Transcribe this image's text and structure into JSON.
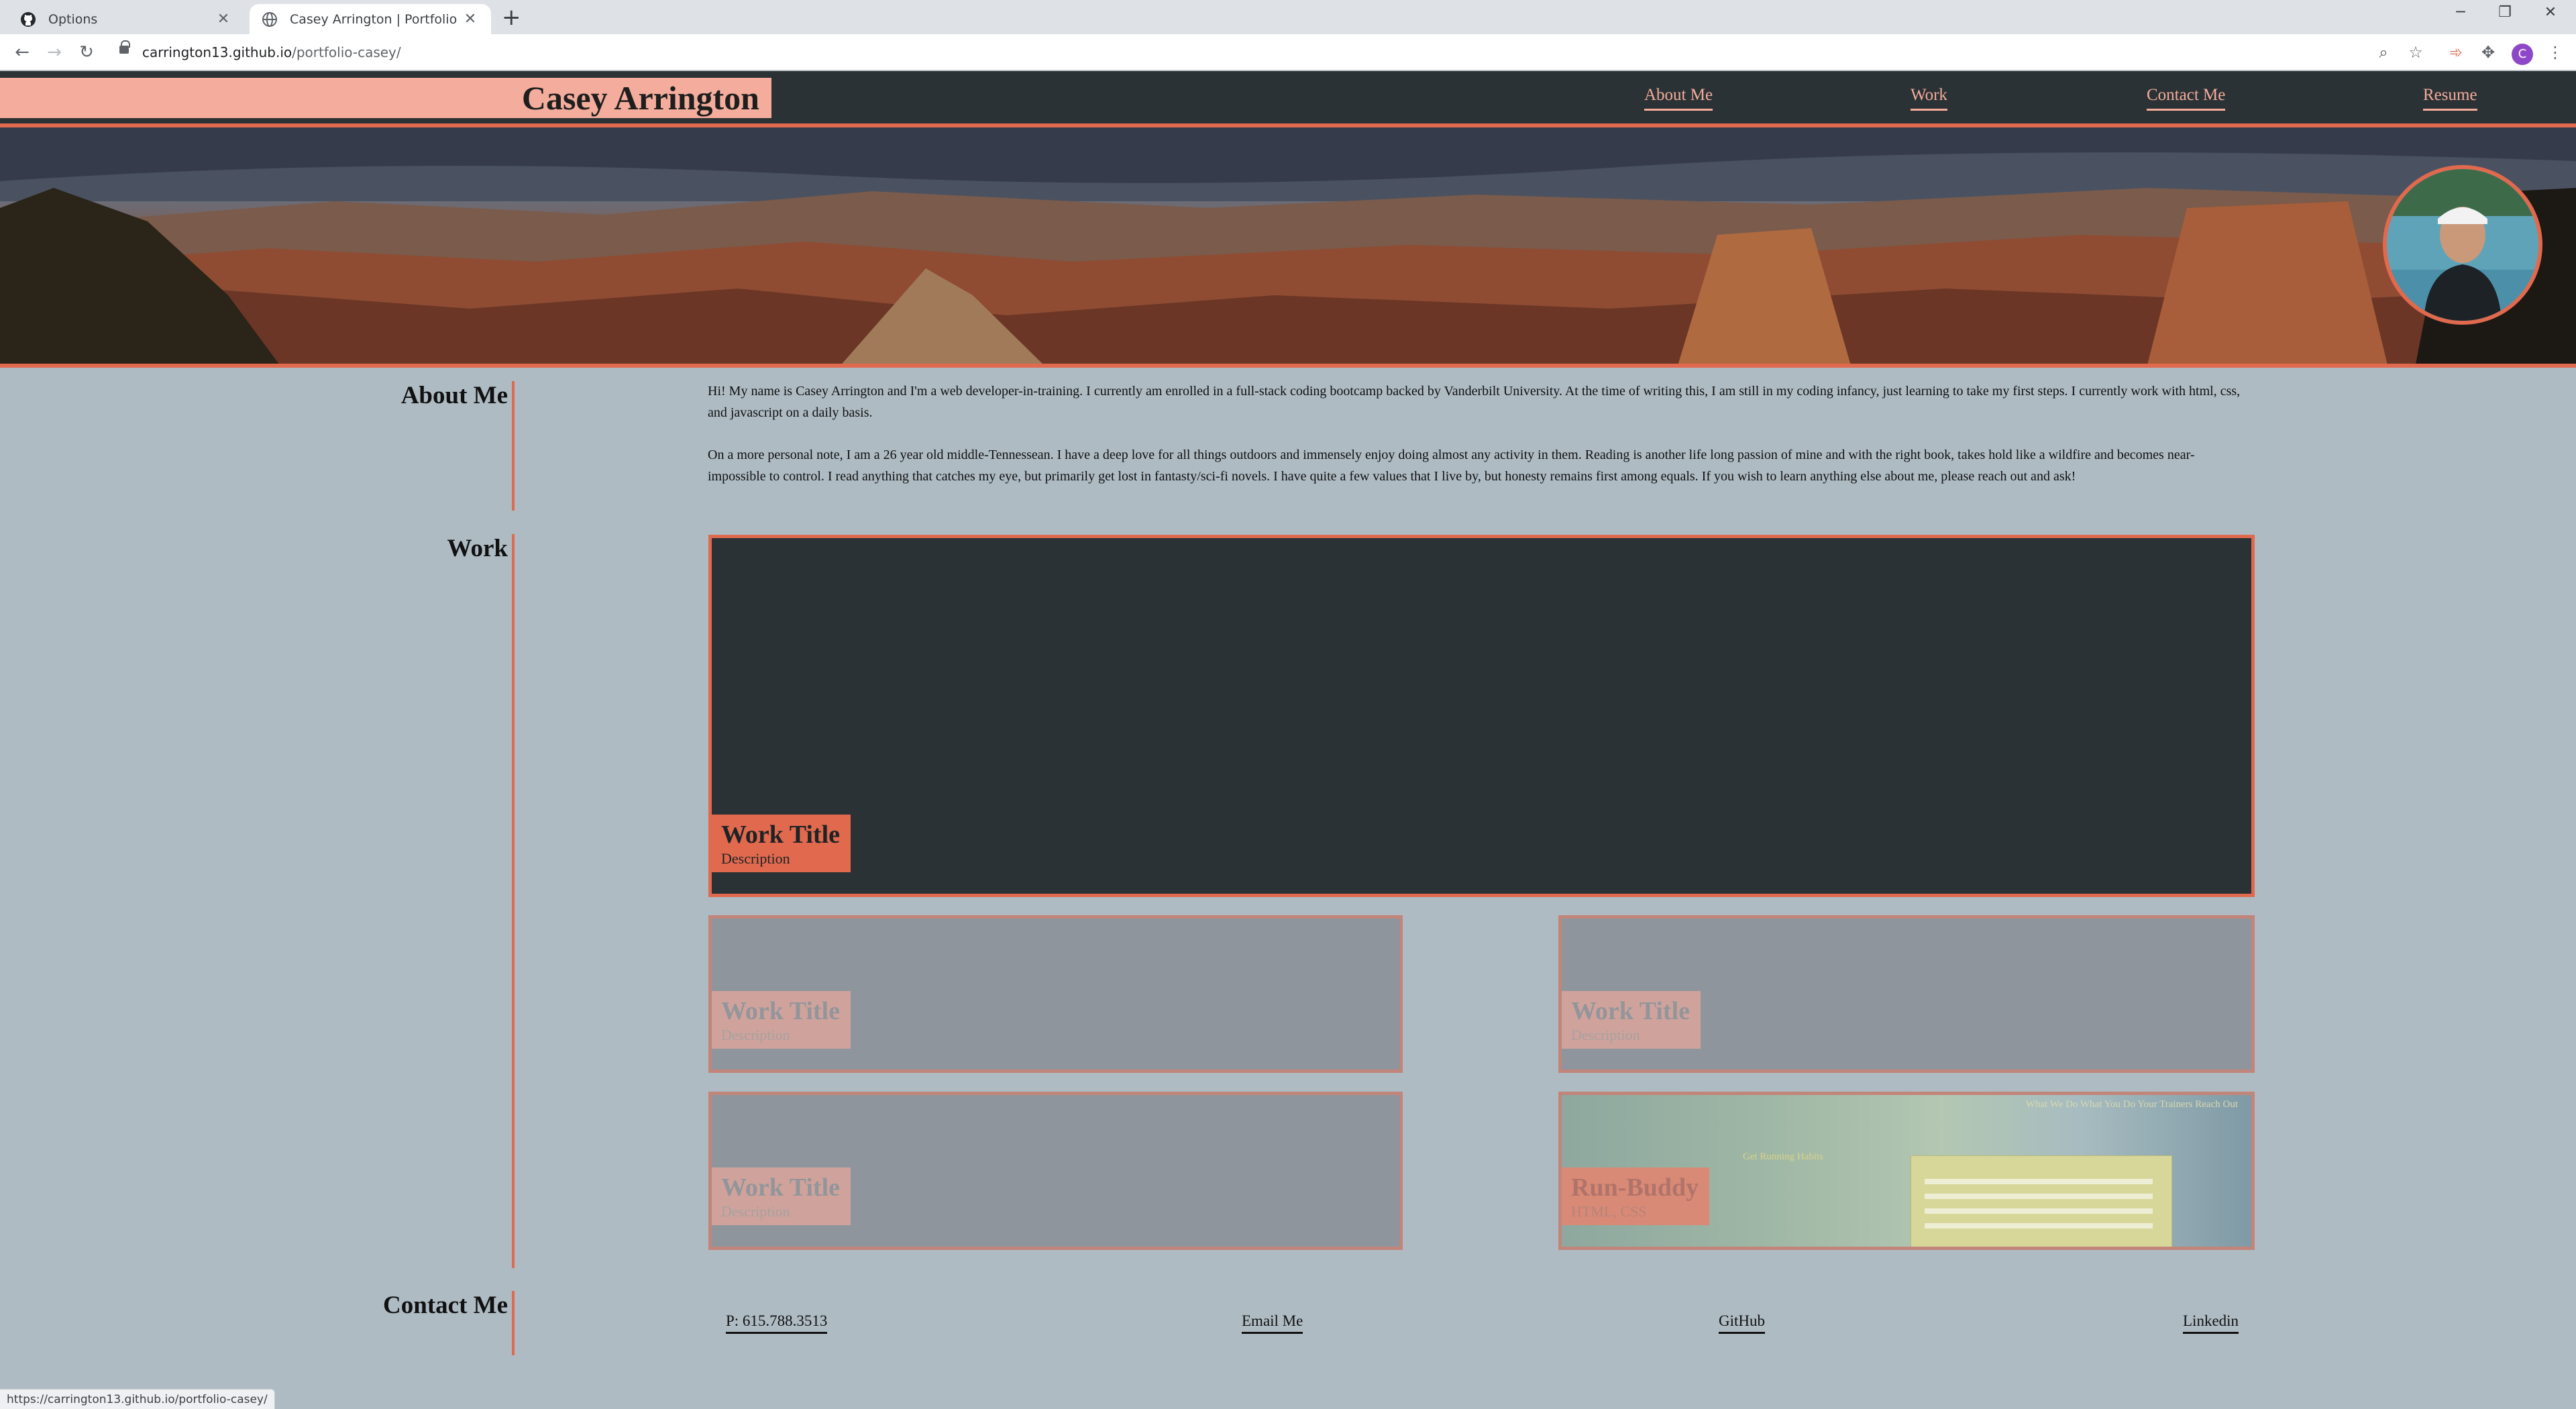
{
  "browser": {
    "tabs": [
      {
        "title": "Options",
        "favicon": "github-icon",
        "active": false
      },
      {
        "title": "Casey Arrington | Portfolio",
        "favicon": "globe-icon",
        "active": true
      }
    ],
    "address": {
      "host": "carrington13.github.io",
      "path": "/portfolio-casey/"
    },
    "profile_initial": "C",
    "status_url": "https://carrington13.github.io/portfolio-casey/"
  },
  "header": {
    "brand": "Casey Arrington",
    "nav": [
      "About Me",
      "Work",
      "Contact Me",
      "Resume"
    ]
  },
  "about": {
    "title": "About Me",
    "paragraphs": [
      "Hi! My name is Casey Arrington and I'm a web developer-in-training. I currently am enrolled in a full-stack coding bootcamp backed by Vanderbilt University. At the time of writing this, I am still in my coding infancy, just learning to take my first steps. I currently work with html, css, and javascript on a daily basis.",
      "On a more personal note, I am a 26 year old middle-Tennessean. I have a deep love for all things outdoors and immensely enjoy doing almost any activity in them. Reading is another life long passion of mine and with the right book, takes hold like a wildfire and becomes near-impossible to control. I read anything that catches my eye, but primarily get lost in fantasty/sci-fi novels. I have quite a few values that I live by, but honesty remains first among equals. If you wish to learn anything else about me, please reach out and ask!"
    ]
  },
  "work": {
    "title": "Work",
    "featured": {
      "title": "Work Title",
      "description": "Description"
    },
    "items": [
      {
        "title": "Work Title",
        "description": "Description"
      },
      {
        "title": "Work Title",
        "description": "Description"
      },
      {
        "title": "Work Title",
        "description": "Description"
      },
      {
        "title": "Run-Buddy",
        "description": "HTML, CSS",
        "preview_nav": "What We Do   What You Do   Your Trainers   Reach Out",
        "preview_headline": "Get Running Habits"
      }
    ]
  },
  "contact": {
    "title": "Contact Me",
    "links": [
      "P: 615.788.3513",
      "Email Me",
      "GitHub",
      "Linkedin"
    ]
  },
  "colors": {
    "accent": "#e0694e",
    "accent_light": "#f4ad9c",
    "dark": "#2b3235",
    "page_bg": "#aebbc3"
  }
}
